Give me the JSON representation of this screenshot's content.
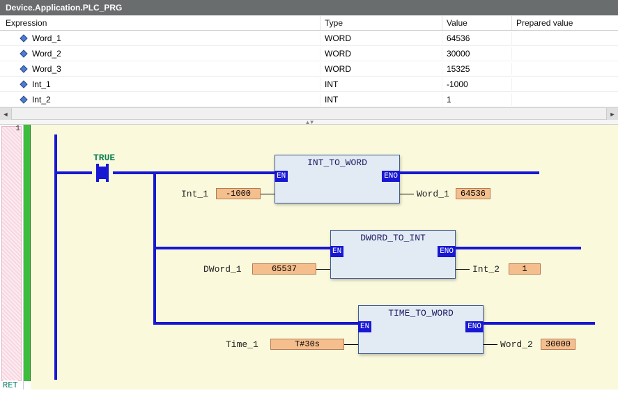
{
  "header": {
    "title": "Device.Application.PLC_PRG"
  },
  "table": {
    "columns": {
      "expression": "Expression",
      "type": "Type",
      "value": "Value",
      "prepared": "Prepared value"
    },
    "rows": [
      {
        "name": "Word_1",
        "type": "WORD",
        "value": "64536",
        "prepared": ""
      },
      {
        "name": "Word_2",
        "type": "WORD",
        "value": "30000",
        "prepared": ""
      },
      {
        "name": "Word_3",
        "type": "WORD",
        "value": "15325",
        "prepared": ""
      },
      {
        "name": "Int_1",
        "type": "INT",
        "value": "-1000",
        "prepared": ""
      },
      {
        "name": "Int_2",
        "type": "INT",
        "value": "1",
        "prepared": ""
      }
    ]
  },
  "gutter": {
    "network_number": "1",
    "return_label": "RET"
  },
  "ladder": {
    "contact_label": "TRUE",
    "blocks": [
      {
        "title": "INT_TO_WORD",
        "en": "EN",
        "eno": "ENO",
        "in_name": "Int_1",
        "in_value": "-1000",
        "out_name": "Word_1",
        "out_value": "64536"
      },
      {
        "title": "DWORD_TO_INT",
        "en": "EN",
        "eno": "ENO",
        "in_name": "DWord_1",
        "in_value": "65537",
        "out_name": "Int_2",
        "out_value": "1"
      },
      {
        "title": "TIME_TO_WORD",
        "en": "EN",
        "eno": "ENO",
        "in_name": "Time_1",
        "in_value": "T#30s",
        "out_name": "Word_2",
        "out_value": "30000"
      }
    ]
  }
}
